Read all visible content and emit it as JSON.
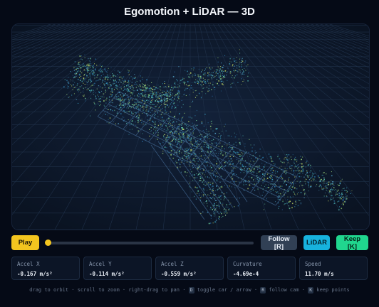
{
  "title": "Egomotion + LiDAR — 3D",
  "controls": {
    "play_label": "Play",
    "follow_label": "Follow [R]",
    "lidar_label": "LiDAR",
    "keep_label": "Keep [K]",
    "playback_progress": 0.0
  },
  "stats": [
    {
      "label": "Accel X",
      "value": "-0.167 m/s²"
    },
    {
      "label": "Accel Y",
      "value": "-0.114 m/s²"
    },
    {
      "label": "Accel Z",
      "value": "-0.559 m/s²"
    },
    {
      "label": "Curvature",
      "value": "-4.69e-4"
    },
    {
      "label": "Speed",
      "value": "11.70 m/s"
    }
  ],
  "hint": {
    "part1": "drag to orbit · scroll to zoom · right-drag to pan · ",
    "key1": "D",
    "part2": " toggle car / arrow · ",
    "key2": "R",
    "part3": " follow cam · ",
    "key3": "K",
    "part4": " keep points"
  },
  "colors": {
    "accent_play": "#f3c51f",
    "accent_lidar": "#17b2dd",
    "accent_keep": "#20d68e",
    "follow_bg": "#314055",
    "background": "#050a16"
  }
}
